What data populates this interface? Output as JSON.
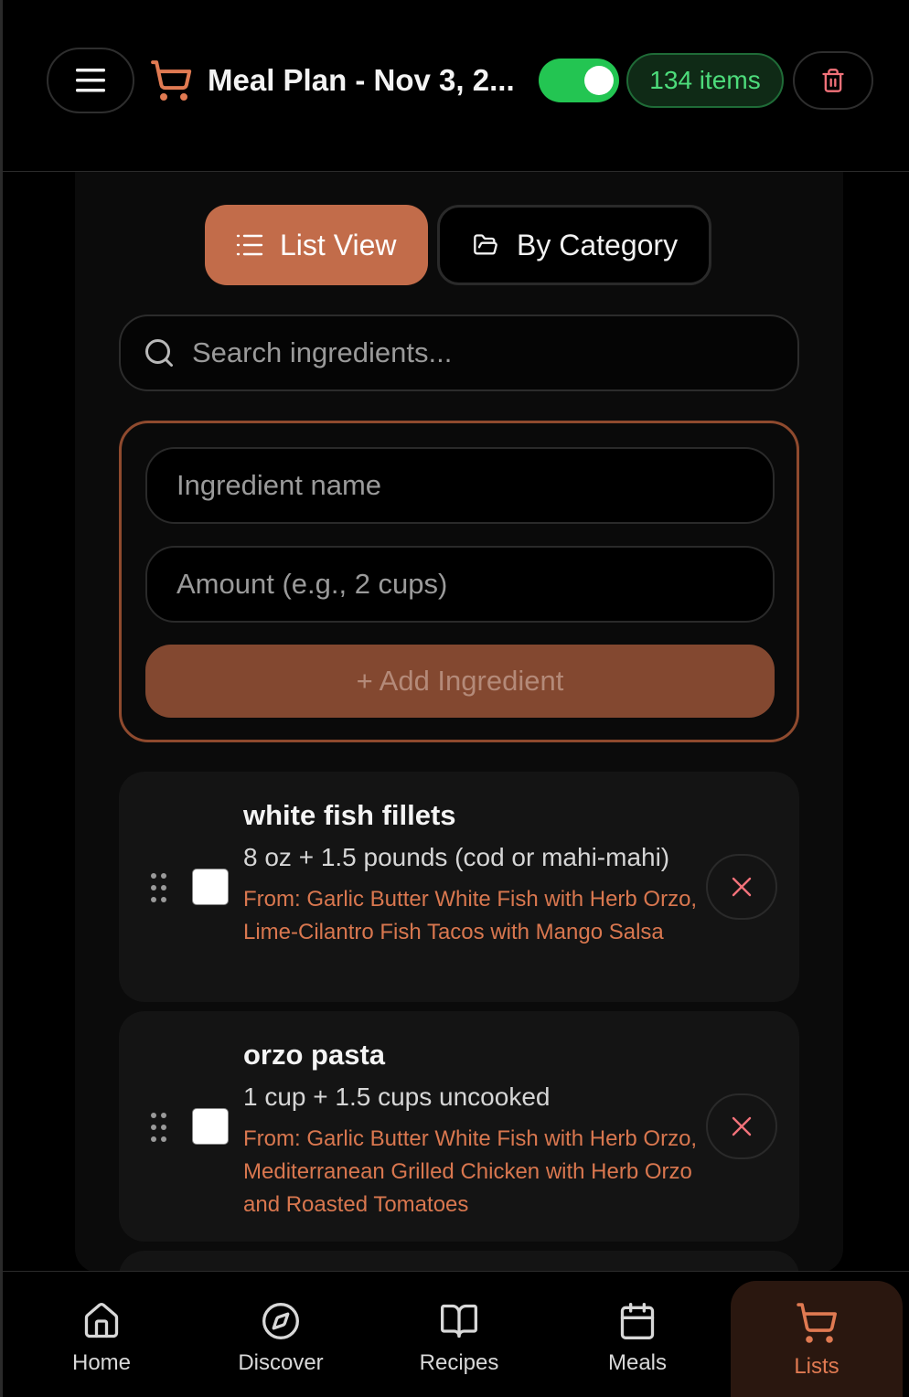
{
  "header": {
    "title": "Meal Plan - Nov 3, 2...",
    "items_count": "134 items",
    "toggle_on": true
  },
  "view_toggle": {
    "list_label": "List View",
    "category_label": "By Category"
  },
  "search": {
    "placeholder": "Search ingredients..."
  },
  "add_form": {
    "name_placeholder": "Ingredient name",
    "amount_placeholder": "Amount (e.g., 2 cups)",
    "add_label": "+ Add Ingredient"
  },
  "items": [
    {
      "name": "white fish fillets",
      "amount": "8 oz + 1.5 pounds (cod or mahi-mahi)",
      "from": "From: Garlic Butter White Fish with Herb Orzo, Lime-Cilantro Fish Tacos with Mango Salsa",
      "checked": false
    },
    {
      "name": "orzo pasta",
      "amount": "1 cup + 1.5 cups uncooked",
      "from": "From: Garlic Butter White Fish with Herb Orzo, Mediterranean Grilled Chicken with Herb Orzo and Roasted Tomatoes",
      "checked": false
    }
  ],
  "nav": {
    "home": "Home",
    "discover": "Discover",
    "recipes": "Recipes",
    "meals": "Meals",
    "lists": "Lists",
    "active": "lists"
  },
  "colors": {
    "accent": "#c26c4a",
    "success": "#23c552",
    "source_text": "#d9774f"
  }
}
